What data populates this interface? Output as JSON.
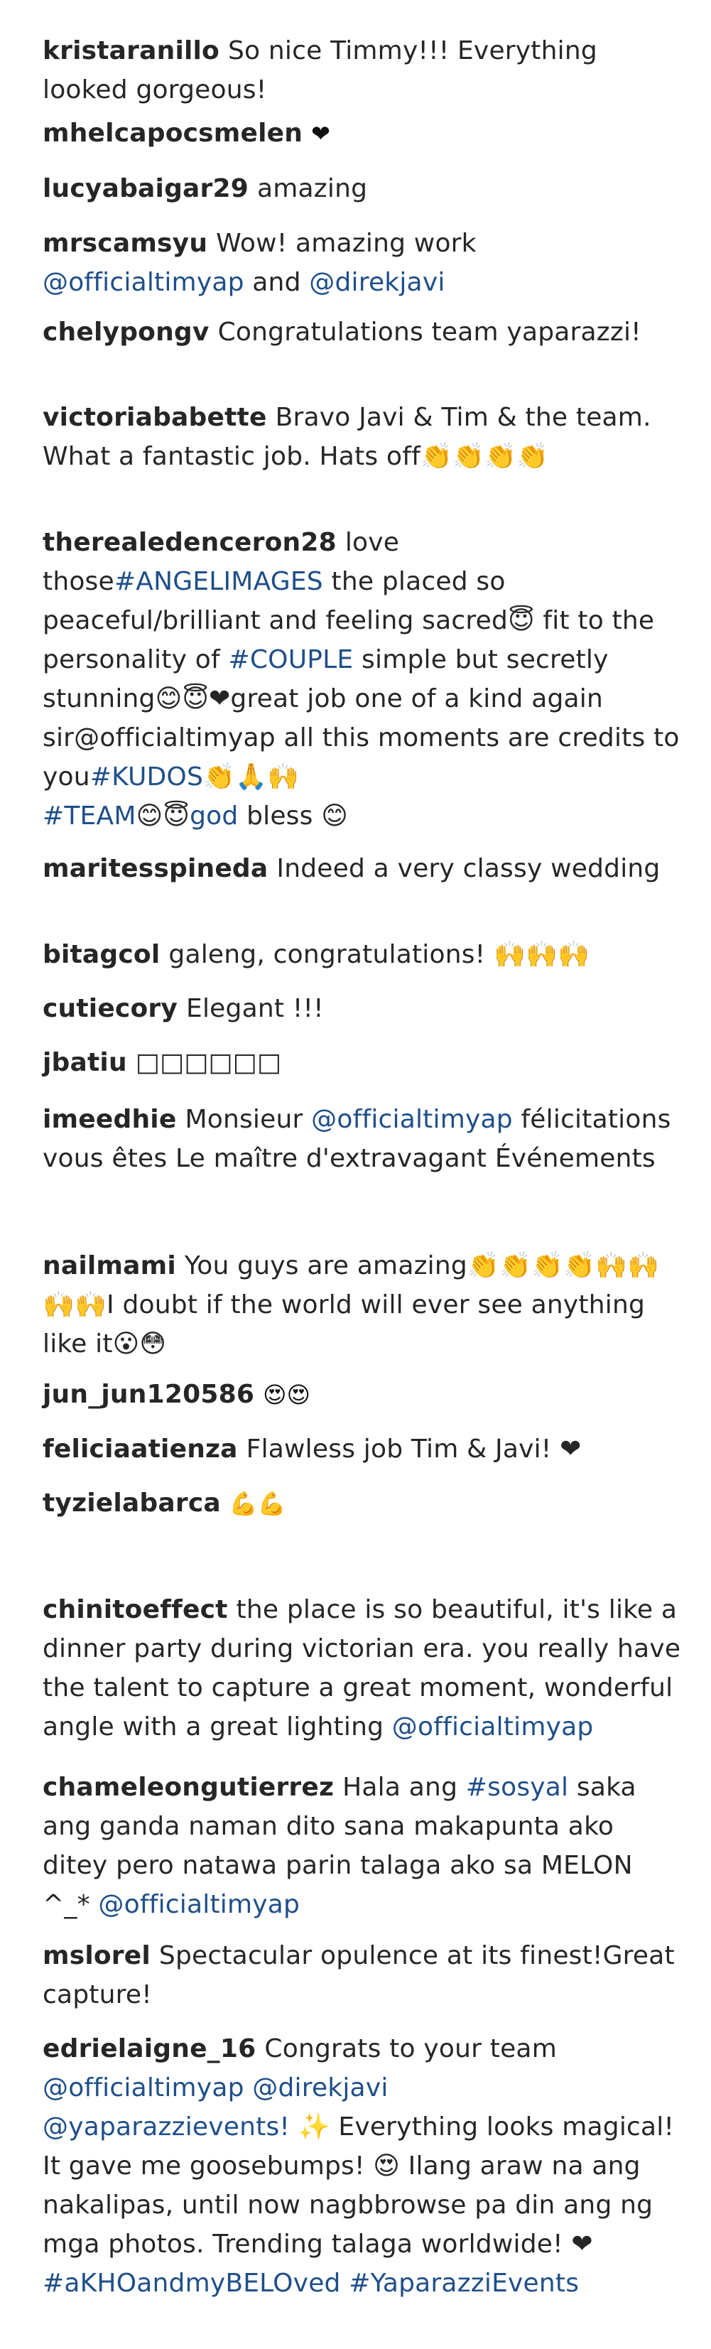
{
  "comments": [
    {
      "user": "kristaranillo",
      "text": "So nice Timmy!!! Everything looked gorgeous!"
    },
    {
      "user": "mhelcapocsmelen",
      "text": "❤"
    },
    {
      "user": "lucyabaigar29",
      "text": "amazing"
    },
    {
      "user": "mrscamsyu",
      "text_a": "Wow! amazing work",
      "link_a": "@officialtimyap",
      "text_b": "and",
      "link_b": "@direkjavi"
    },
    {
      "user": "chelypongv",
      "text": "Congratulations team yaparazzi!"
    },
    {
      "user": "victoriababette",
      "text": "Bravo Javi & Tim & the team. What a fantastic job. Hats off👏👏👏👏"
    },
    {
      "user": "therealedenceron28",
      "text_a": "love those",
      "tag_a": "#ANGELIMAGES",
      "text_b": "the placed so peaceful/brilliant and feeling sacred😇 fit to the personality of",
      "tag_b": "#COUPLE",
      "text_c": "simple but secretly stunning😊😇❤great job one of a kind again sir@officialtimyap all this moments are credits to you",
      "tag_c": "#KUDOS",
      "text_d": "👏🙏🙌",
      "tag_d": "#TEAM",
      "text_e": "😊😇",
      "tag_e": "god",
      "text_f": "bless 😊"
    },
    {
      "user": "maritesspineda",
      "text": "Indeed a very classy wedding"
    },
    {
      "user": "bitagcol",
      "text": "galeng, congratulations! 🙌🙌🙌"
    },
    {
      "user": "cutiecory",
      "text": "Elegant !!!"
    },
    {
      "user": "jbatiu",
      "text": "□□□□□□"
    },
    {
      "user": "imeedhie",
      "text_a": "Monsieur",
      "link_a": "@officialtimyap",
      "text_b": "félicitations vous êtes Le maître d'extravagant Événements"
    },
    {
      "user": "nailmami",
      "text": "You guys are amazing👏👏👏👏🙌🙌🙌🙌I doubt if the world will ever see anything like it😮😳"
    },
    {
      "user": "jun_jun120586",
      "text": "😍😍"
    },
    {
      "user": "feliciaatienza",
      "text": "Flawless job Tim & Javi! ❤"
    },
    {
      "user": "tyzielabarca",
      "text": "💪💪"
    },
    {
      "user": "chinitoeffect",
      "text_a": "the place is so beautiful, it's like a dinner party during victorian era. you really have the talent to capture a great moment, wonderful angle with a great lighting",
      "link_a": "@officialtimyap"
    },
    {
      "user": "chameleongutierrez",
      "text_a": "Hala ang",
      "tag_a": "#sosyal",
      "text_b": "saka ang ganda naman dito sana makapunta ako ditey pero natawa parin talaga ako sa MELON ^_*",
      "link_a": "@officialtimyap"
    },
    {
      "user": "mslorel",
      "text": "Spectacular opulence at its finest!Great capture!"
    },
    {
      "user": "edrielaigne_16",
      "text_a": "Congrats to your team",
      "link_a": "@officialtimyap",
      "link_b": "@direkjavi",
      "link_c": "@yaparazzievents!",
      "text_b": "✨ Everything looks magical! It gave me goosebumps! 😍 Ilang araw na ang nakalipas, until now nagbbrowse pa din ang ng mga photos. Trending talaga worldwide! ❤",
      "tag_a": "#aKHOandmyBELOved",
      "tag_b": "#YaparazziEvents"
    }
  ],
  "colors": {
    "text": "#262626",
    "link": "#1f4f8a",
    "background": "#ffffff"
  }
}
